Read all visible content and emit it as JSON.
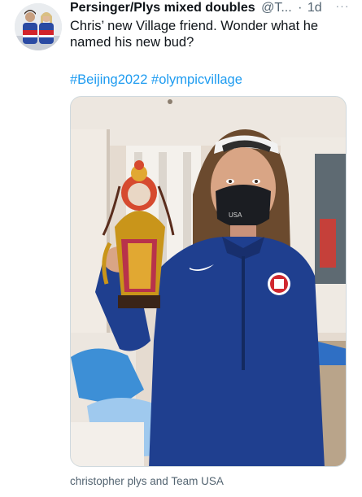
{
  "tweet": {
    "author_name": "Persinger/Plys mixed doubles",
    "handle": "@T...",
    "separator": "·",
    "time": "1d",
    "more_label": "···",
    "text": "Chris’ new Village friend. Wonder what he named his new bud?",
    "hashtags": [
      "#Beijing2022",
      "#olympicvillage"
    ],
    "caption": "christopher plys and Team USA"
  },
  "photo": {
    "mask_text": "USA"
  },
  "colors": {
    "link": "#1d9bf0",
    "muted": "#536471",
    "text": "#0f1419",
    "jacket": "#1f3f8f"
  }
}
